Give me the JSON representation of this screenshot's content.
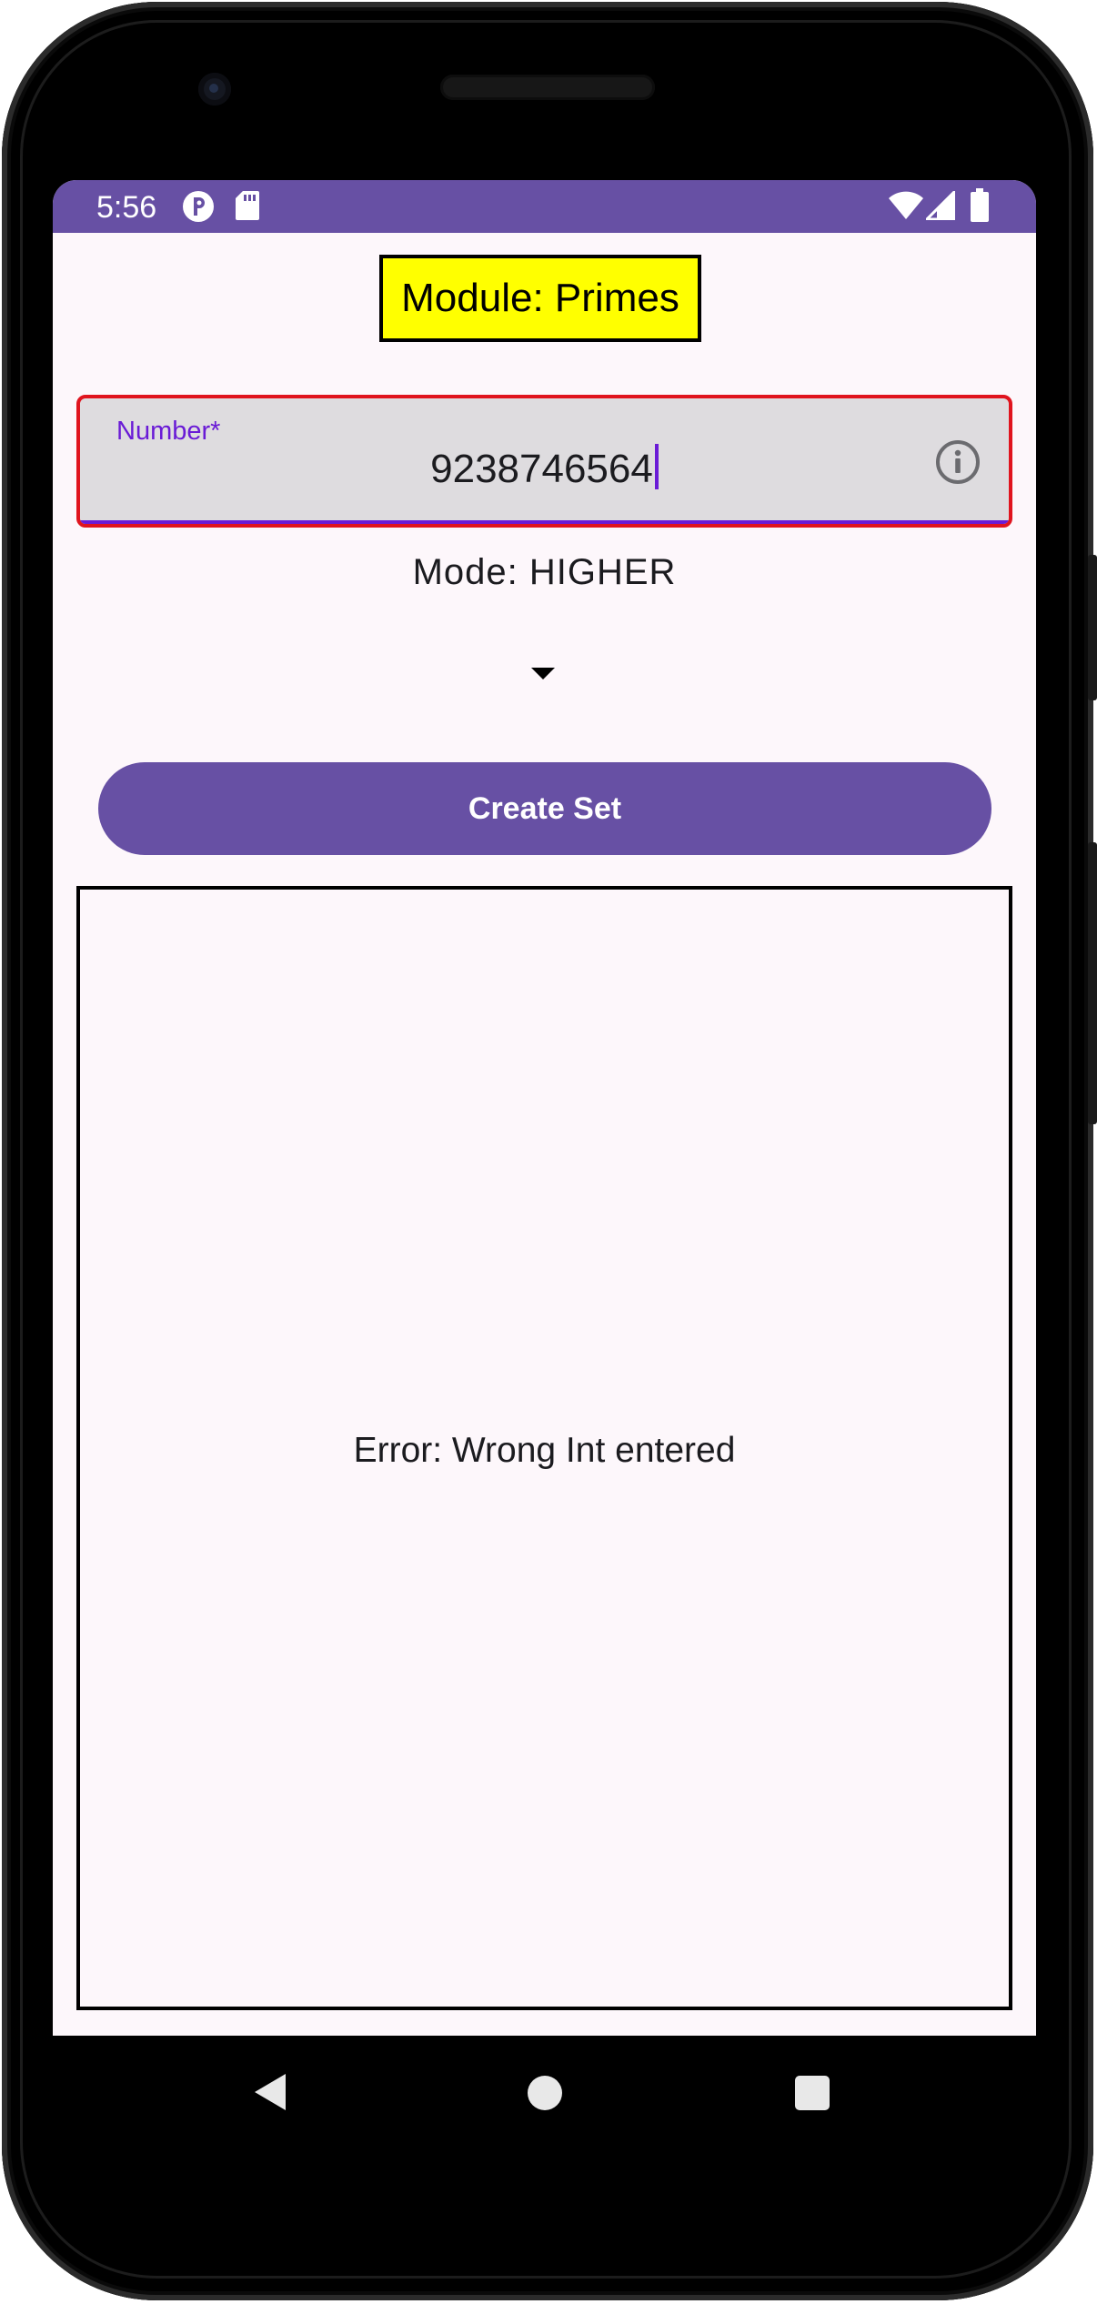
{
  "status_bar": {
    "time": "5:56",
    "left_icons": [
      "pinwheel-notification-icon",
      "sd-card-icon"
    ],
    "right_icons": [
      "wifi-icon",
      "cell-signal-icon",
      "battery-icon"
    ],
    "background_color": "#6750a4"
  },
  "app": {
    "module_title": "Module: Primes",
    "number_field": {
      "label": "Number*",
      "value": "9238746564",
      "trailing_icon": "info-icon",
      "error_border_color": "#e0141e",
      "label_color": "#6a1bd6"
    },
    "mode_label": "Mode: HIGHER",
    "mode_dropdown_icon": "dropdown-arrow-icon",
    "create_button_label": "Create Set",
    "result_text": "Error: Wrong Int entered"
  },
  "navigation": {
    "back_icon": "back-triangle-icon",
    "home_icon": "home-circle-icon",
    "recents_icon": "recents-square-icon"
  },
  "colors": {
    "primary": "#6750a4",
    "title_highlight": "#ffff00",
    "screen_background": "#fdf7fb"
  }
}
